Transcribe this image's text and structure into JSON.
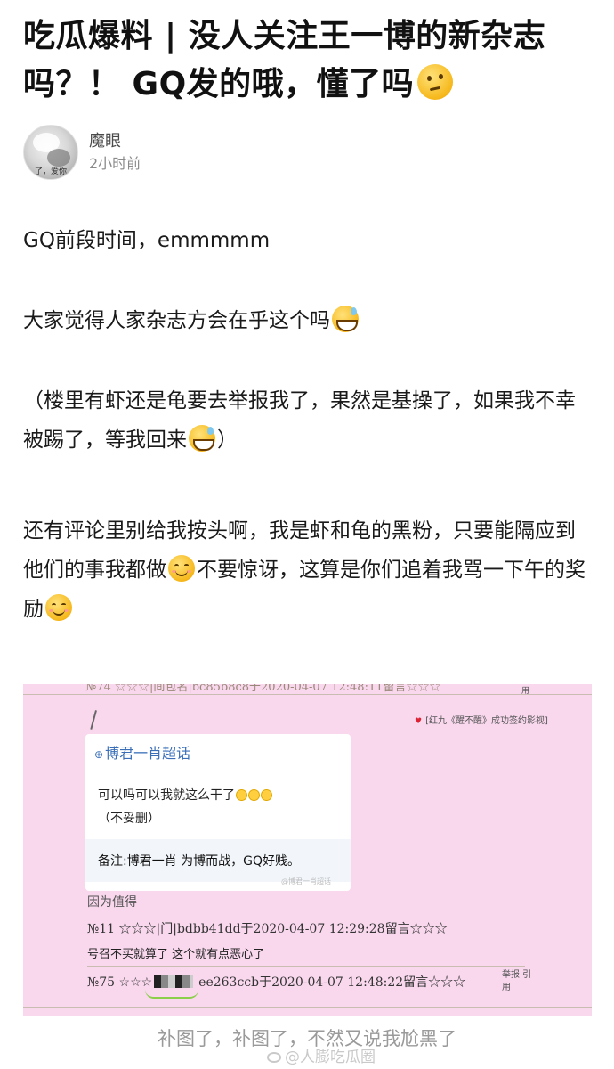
{
  "post": {
    "title": "吃瓜爆料 | 没人关注王一博的新杂志吗？！ GQ发的哦，懂了吗",
    "author": {
      "name": "魔眼",
      "time": "2小时前",
      "avatar_text": "了，爱你"
    },
    "paragraphs": {
      "p1": "GQ前段时间，emmmmm",
      "p2": "大家觉得人家杂志方会在乎这个吗",
      "p3a": "（楼里有虾还是龟要去举报我了，果然是基操了，如果我不幸被踢了，等我回来",
      "p3b": "）",
      "p4a": "还有评论里别给我按头啊，我是虾和龟的黑粉，只要能隔应到他们的事我都做",
      "p4b": "不要惊讶，这算是你们追着我骂一下午的奖励"
    }
  },
  "embed": {
    "top_faded": "№74 ☆☆☆|间包名|bc85b8c8于2020-04-07 12:48:11留言☆☆☆",
    "top_right": "用",
    "movie_note": "[红九《醒不醒》成功签约影视]",
    "card": {
      "topic": "博君一肖超话",
      "line1": "可以吗可以我就这么干了",
      "line2": "（不妥删）",
      "note": "备注:博君一肖 为博而战，GQ好贱。",
      "watermark": "@博君一肖超话"
    },
    "reason": "因为值得",
    "meta1": "№11 ☆☆☆|门|bdbb41dd于2020-04-07 12:29:28留言☆☆☆",
    "reply": "号召不买就算了 这个就有点恶心了",
    "meta2_prefix": "№75 ☆☆☆",
    "meta2_suffix": "ee263ccb于2020-04-07 12:48:22留言☆☆☆",
    "tools_report": "举报 引",
    "tools_use": "用"
  },
  "caption": "补图了，补图了，不然又说我尬黑了",
  "watermark": "@人膨吃瓜圈",
  "icons": [
    "thinking-emoji",
    "sweat-smile-emoji",
    "smile-emoji"
  ],
  "colors": {
    "embed_bg": "#f9d8ee",
    "topic_blue": "#3a6fb8",
    "caption_gray": "#9a9a9a"
  }
}
